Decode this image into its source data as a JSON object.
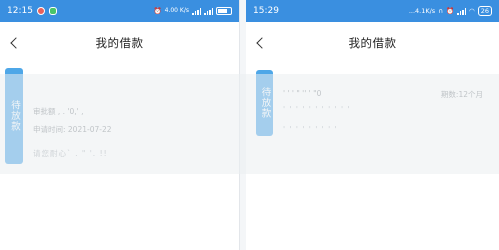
{
  "left_screen": {
    "status": {
      "time": "12:15",
      "network_speed": "4.00\nK/s",
      "battery": "61"
    },
    "header": {
      "title": "我的借款"
    },
    "card": {
      "tag": "待放款",
      "line1": "审批额 ,  .  '0,' ,",
      "line2": "申请时间: 2021-07-22",
      "line3": "请您耐心` .  \"  '. !!"
    }
  },
  "right_screen": {
    "status": {
      "time": "15:29",
      "network_speed": "...4.1K/s",
      "battery": "26"
    },
    "header": {
      "title": "我的借款"
    },
    "card": {
      "tag": "待放款",
      "line1": "' ' ' \" '' ' \"0",
      "line1_right": "期数:12个月",
      "line2": "' ' ' ' ' ' ' ' ' '  '",
      "line3": "' ' ' ' ' ' ' ' '"
    }
  },
  "colors": {
    "statusbar": "#3a8fe0",
    "tag": "#4ea7e8"
  }
}
